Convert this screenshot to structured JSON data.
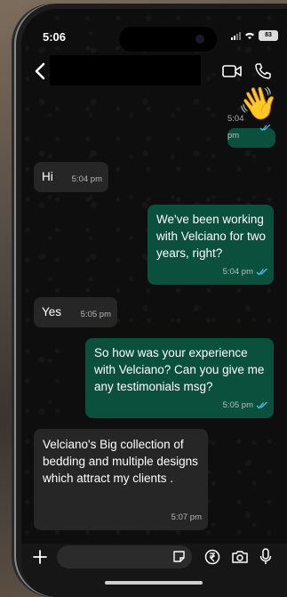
{
  "status_bar": {
    "time": "5:06",
    "battery": "83"
  },
  "header": {
    "back_icon": "chevron-left-icon",
    "video_icon": "video-call-icon",
    "call_icon": "phone-icon"
  },
  "messages": [
    {
      "direction": "out",
      "emoji": "👋",
      "time": "5:04 pm",
      "status": "read"
    },
    {
      "direction": "in",
      "text": "Hi",
      "time": "5:04 pm"
    },
    {
      "direction": "out",
      "text": "We've been working with Velciano for two years, right?",
      "time": "5:04 pm",
      "status": "read"
    },
    {
      "direction": "in",
      "text": "Yes",
      "time": "5:05 pm"
    },
    {
      "direction": "out",
      "text": "So how was your experience with Velciano? Can you give me any testimonials msg?",
      "time": "5:05 pm",
      "status": "read"
    },
    {
      "direction": "in",
      "text": "Velciano's Big collection of bedding and multiple designs which attract my clients .",
      "time": "5:07 pm"
    }
  ],
  "input_bar": {
    "placeholder": "",
    "icons": [
      "plus-icon",
      "sticker-icon",
      "payment-icon",
      "camera-icon",
      "microphone-icon"
    ]
  },
  "colors": {
    "outgoing_bubble": "#0b4f3d",
    "incoming_bubble": "#262626",
    "read_ticks": "#53bdeb"
  }
}
